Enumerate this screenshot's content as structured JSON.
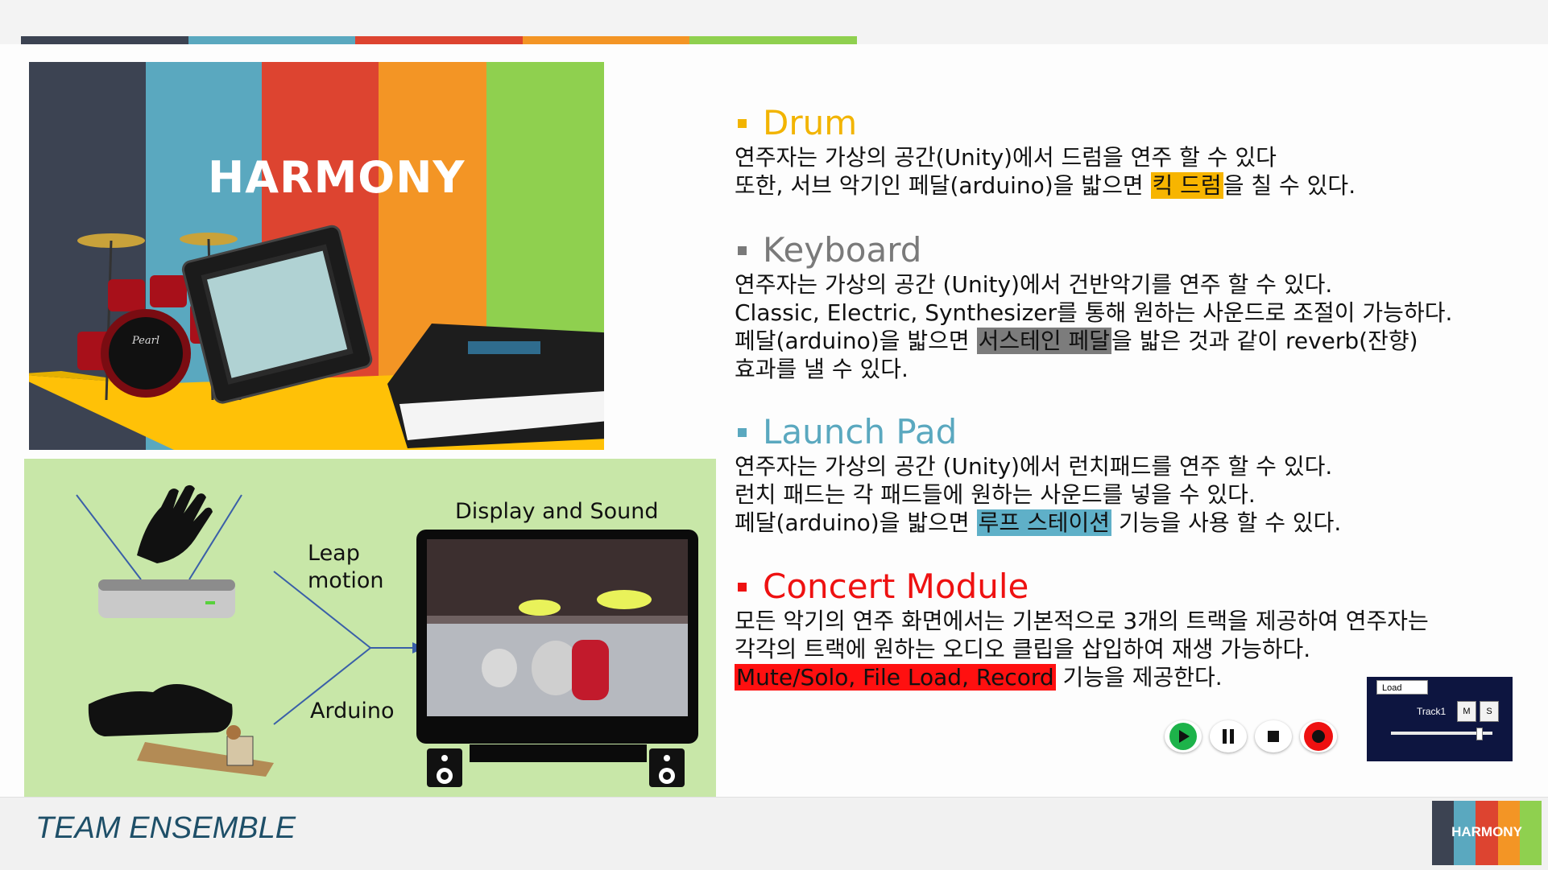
{
  "colors": {
    "stripe1": "#3c4352",
    "stripe2": "#5aa8bf",
    "stripe3": "#dd4430",
    "stripe4": "#f39525",
    "stripe5": "#8fd04f",
    "floor": "#ffc107",
    "diagram_bg": "#c8e7a8",
    "drum": "#f2b400",
    "keyboard": "#7a7a7a",
    "launchpad": "#5aa8bf",
    "concert": "#ee1111",
    "hl_drum": "#f7b500",
    "hl_keyboard": "#7c7c7c",
    "hl_launch": "#5fb0c8",
    "hl_concert": "#ff1010",
    "team": "#1e4f68"
  },
  "hero": {
    "title": "HARMONY"
  },
  "diagram": {
    "leap_label_1": "Leap",
    "leap_label_2": "motion",
    "arduino_label": "Arduino",
    "display_label": "Display and Sound"
  },
  "sections": {
    "drum": {
      "title": "Drum",
      "line1": "연주자는 가상의 공간(Unity)에서 드럼을 연주 할 수 있다",
      "line2_pre": "또한, 서브 악기인 페달(arduino)을 밟으면 ",
      "line2_hl": "킥 드럼",
      "line2_post": "을 칠 수 있다."
    },
    "keyboard": {
      "title": "Keyboard",
      "line1": "연주자는 가상의 공간 (Unity)에서 건반악기를 연주 할 수 있다.",
      "line2": "Classic, Electric, Synthesizer를 통해 원하는 사운드로 조절이 가능하다.",
      "line3_pre": "페달(arduino)을  밟으면 ",
      "line3_hl": "서스테인 페달",
      "line3_post": "을  밟은  것과  같이  reverb(잔향)",
      "line4": "효과를 낼 수 있다."
    },
    "launchpad": {
      "title": "Launch Pad",
      "line1": "연주자는 가상의 공간 (Unity)에서 런치패드를 연주 할 수 있다.",
      "line2": "런치 패드는 각 패드들에 원하는 사운드를 넣을 수 있다.",
      "line3_pre": "페달(arduino)을 밟으면 ",
      "line3_hl": "루프 스테이션",
      "line3_post": " 기능을 사용 할 수 있다."
    },
    "concert": {
      "title": "Concert Module",
      "line1": "모든  악기의  연주  화면에서는  기본적으로  3개의  트랙을  제공하여  연주자는",
      "line2": "각각의 트랙에 원하는 오디오 클립을 삽입하여 재생 가능하다.",
      "line3_hl": "Mute/Solo, File Load, Record",
      "line3_post": " 기능을 제공한다."
    }
  },
  "track_panel": {
    "load_label": "Load",
    "track_label": "Track1",
    "mute_label": "M",
    "solo_label": "S"
  },
  "footer": {
    "team": "TEAM ENSEMBLE",
    "logo_text": "HARMONY"
  }
}
